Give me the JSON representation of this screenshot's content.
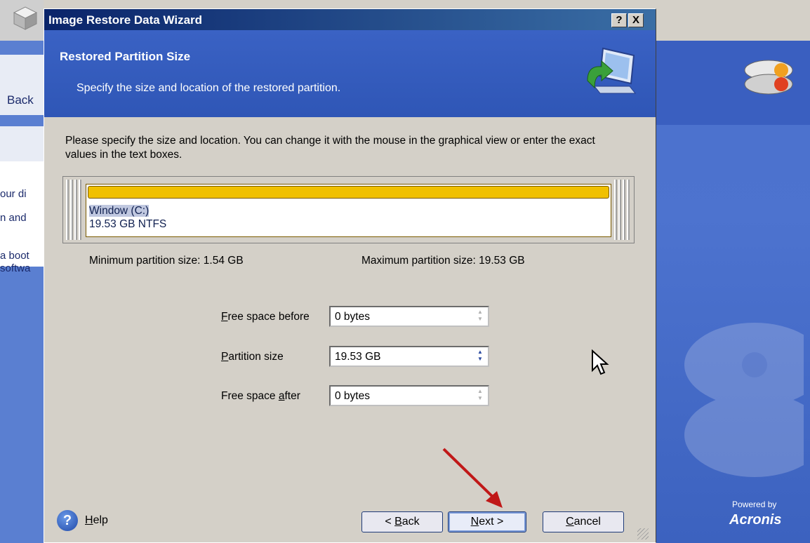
{
  "background_app": {
    "left_back_label": "Back",
    "left_text_lines": [
      "our di",
      "n and",
      "a boot",
      "softwa"
    ],
    "powered_by": "Powered by",
    "brand": "Acronis"
  },
  "dialog": {
    "title": "Image Restore Data Wizard",
    "title_help_button": "?",
    "title_close_button": "X",
    "banner": {
      "title": "Restored Partition Size",
      "subtitle": "Specify the size and location of the restored partition."
    },
    "instructions": "Please specify the size and location. You can change it with the mouse in the graphical view or enter the exact values in the text boxes.",
    "partition": {
      "name": "Window (C:)",
      "size_fs": "19.53 GB  NTFS"
    },
    "min_size_label": "Minimum partition size:  1.54 GB",
    "max_size_label": "Maximum partition size:  19.53 GB",
    "fields": {
      "free_before": {
        "label_prefix": "",
        "label_accel": "F",
        "label_rest": "ree space before",
        "value": "0 bytes"
      },
      "partition_size": {
        "label_prefix": "",
        "label_accel": "P",
        "label_rest": "artition size",
        "value": "19.53 GB"
      },
      "free_after": {
        "label_prefix": "Free space ",
        "label_accel": "a",
        "label_rest": "fter",
        "value": "0 bytes"
      }
    },
    "buttons": {
      "help_accel": "H",
      "help_rest": "elp",
      "back_prefix": "< ",
      "back_accel": "B",
      "back_rest": "ack",
      "next_accel": "N",
      "next_rest": "ext >",
      "cancel_accel": "C",
      "cancel_rest": "ancel"
    }
  },
  "colors": {
    "title_bar": "#0a246a",
    "banner": "#3a62c4",
    "partition_bar": "#f0c000",
    "annotation_arrow": "#c01818"
  }
}
